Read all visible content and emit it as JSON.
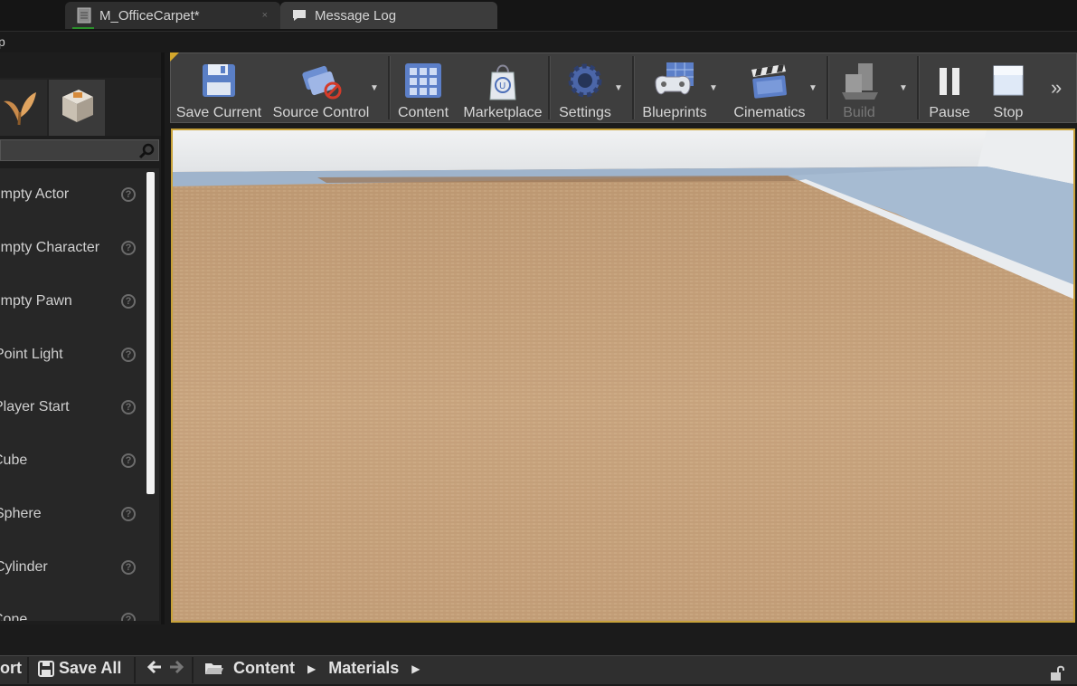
{
  "tabs": [
    {
      "label": "M_OfficeCarpet*",
      "icon": "material-file-icon",
      "close": "×"
    },
    {
      "label": "Message Log",
      "icon": "message-bubble-icon",
      "close": "×"
    }
  ],
  "menubar": {
    "fragment": "p"
  },
  "place_panel": {
    "mode_icons": [
      "foliage-mode-icon",
      "mesh-paint-mode-icon"
    ],
    "search_icon": "search-icon",
    "items": [
      {
        "label": "Empty Actor"
      },
      {
        "label": "Empty Character"
      },
      {
        "label": "Empty Pawn"
      },
      {
        "label": "Point Light"
      },
      {
        "label": "Player Start"
      },
      {
        "label": "Cube"
      },
      {
        "label": "Sphere"
      },
      {
        "label": "Cylinder"
      },
      {
        "label": "Cone"
      }
    ],
    "help_glyph": "?"
  },
  "toolbar": {
    "save_current": "Save Current",
    "source_control": "Source Control",
    "content": "Content",
    "marketplace": "Marketplace",
    "settings": "Settings",
    "blueprints": "Blueprints",
    "cinematics": "Cinematics",
    "build": "Build",
    "pause": "Pause",
    "stop": "Stop",
    "more": "»"
  },
  "bottom": {
    "import_fragment": "ort",
    "save_all": "Save All",
    "path": [
      "Content",
      "Materials"
    ]
  },
  "colors": {
    "accent": "#d4a72c",
    "carpet": "#c9a47c",
    "wall": "#e4e7ea",
    "floor_blue": "#a9bdd3"
  }
}
